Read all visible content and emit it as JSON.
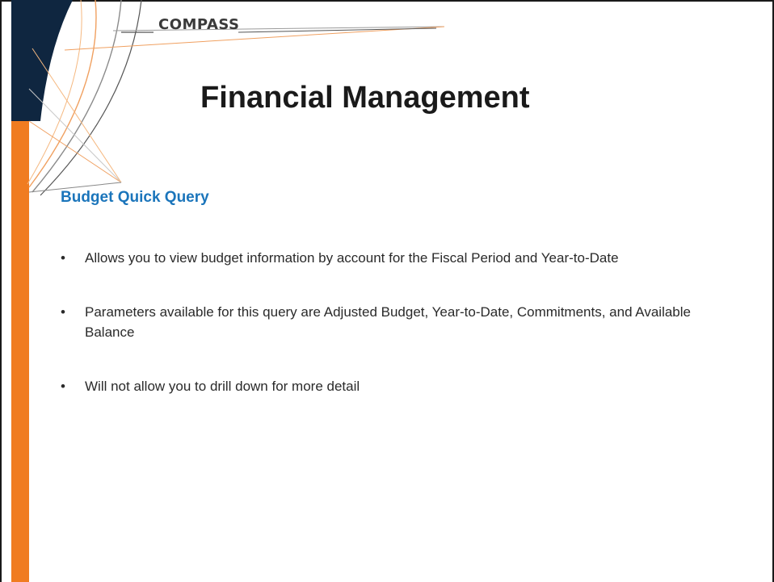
{
  "logo": {
    "text": "COMPASS"
  },
  "title": "Financial Management",
  "subtitle": "Budget Quick Query",
  "bullets": [
    "Allows you to view budget information by account for the Fiscal Period and Year-to-Date",
    "Parameters available for this query are Adjusted Budget, Year-to-Date, Commitments, and Available Balance",
    "Will not allow you to drill down for more detail"
  ],
  "colors": {
    "navy": "#0f2640",
    "orange": "#f07c21",
    "subtitle_blue": "#1b75bb",
    "text": "#2a2a2a"
  },
  "icons": {
    "logo_mark": "compass-arcs-logo"
  }
}
